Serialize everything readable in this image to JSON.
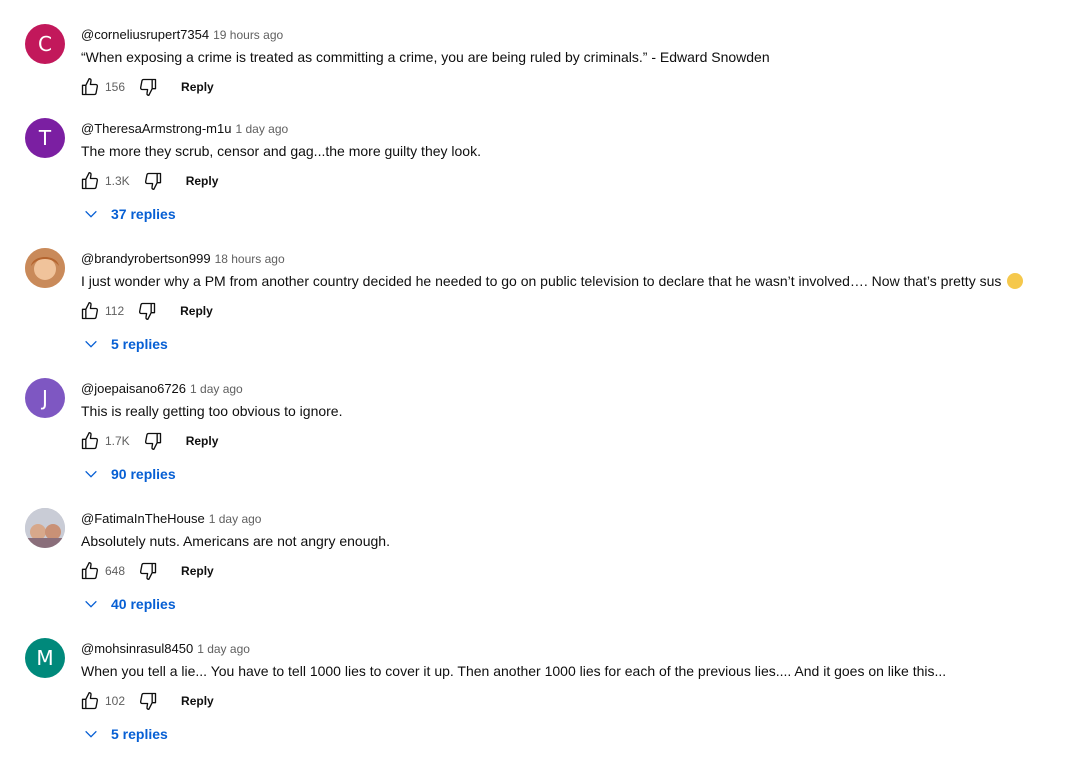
{
  "comments": [
    {
      "author": "@corneliusrupert7354",
      "time": "19 hours ago",
      "text": "“When exposing a crime is treated as committing a crime, you are being ruled by criminals.” - Edward Snowden",
      "likes": "156",
      "reply_label": "Reply",
      "avatar_letter": "C",
      "avatar_color": "#c2185b",
      "replies": ""
    },
    {
      "author": "@TheresaArmstrong-m1u",
      "time": "1 day ago",
      "text": "The more they scrub, censor and gag...the more guilty they look.",
      "likes": "1.3K",
      "reply_label": "Reply",
      "avatar_letter": "T",
      "avatar_color": "#7b1fa2",
      "replies": "37 replies"
    },
    {
      "author": "@brandyrobertson999",
      "time": "18 hours ago",
      "text": "I just wonder why a PM from another country decided he needed to go on public television to declare that he wasn’t involved…. Now that’s pretty sus",
      "likes": "112",
      "reply_label": "Reply",
      "avatar_letter": "",
      "avatar_color": "#e9b48a",
      "replies": "5 replies",
      "emoji": "thinking-face-emoji"
    },
    {
      "author": "@joepaisano6726",
      "time": "1 day ago",
      "text": "This is really getting too obvious to ignore.",
      "likes": "1.7K",
      "reply_label": "Reply",
      "avatar_letter": "J",
      "avatar_color": "#7e57c2",
      "replies": "90 replies"
    },
    {
      "author": "@FatimaInTheHouse",
      "time": "1 day ago",
      "text": "Absolutely nuts. Americans are not angry enough.",
      "likes": "648",
      "reply_label": "Reply",
      "avatar_letter": "",
      "avatar_color": "#b8b8c4",
      "replies": "40 replies"
    },
    {
      "author": "@mohsinrasul8450",
      "time": "1 day ago",
      "text": "When you tell a lie... You have to tell 1000 lies to cover it up. Then another 1000 lies for each of the previous lies.... And it goes on like this...",
      "likes": "102",
      "reply_label": "Reply",
      "avatar_letter": "M",
      "avatar_color": "#00897b",
      "replies": "5 replies"
    }
  ]
}
